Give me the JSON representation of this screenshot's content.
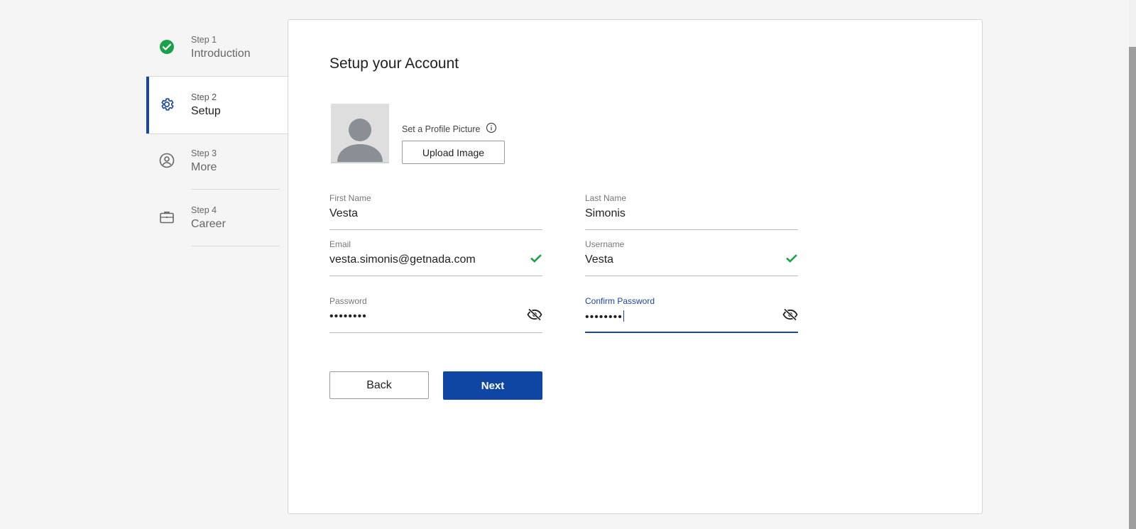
{
  "steps": [
    {
      "num": "Step 1",
      "name": "Introduction",
      "state": "complete",
      "icon": "check-circle-icon"
    },
    {
      "num": "Step 2",
      "name": "Setup",
      "state": "active",
      "icon": "gear-icon"
    },
    {
      "num": "Step 3",
      "name": "More",
      "state": "pending",
      "icon": "user-circle-icon"
    },
    {
      "num": "Step 4",
      "name": "Career",
      "state": "pending",
      "icon": "briefcase-icon"
    }
  ],
  "form": {
    "title": "Setup your Account",
    "profile_picture_label": "Set a Profile Picture",
    "upload_label": "Upload Image",
    "first_name": {
      "label": "First Name",
      "value": "Vesta"
    },
    "last_name": {
      "label": "Last Name",
      "value": "Simonis"
    },
    "email": {
      "label": "Email",
      "value": "vesta.simonis@getnada.com",
      "valid": true
    },
    "username": {
      "label": "Username",
      "value": "Vesta",
      "valid": true
    },
    "password": {
      "label": "Password",
      "value": "••••••••"
    },
    "confirm_password": {
      "label": "Confirm Password",
      "value": "••••••••"
    },
    "back_label": "Back",
    "next_label": "Next"
  },
  "colors": {
    "accent": "#0f46a3",
    "success": "#1aa24a",
    "background": "#f5f5f5"
  }
}
